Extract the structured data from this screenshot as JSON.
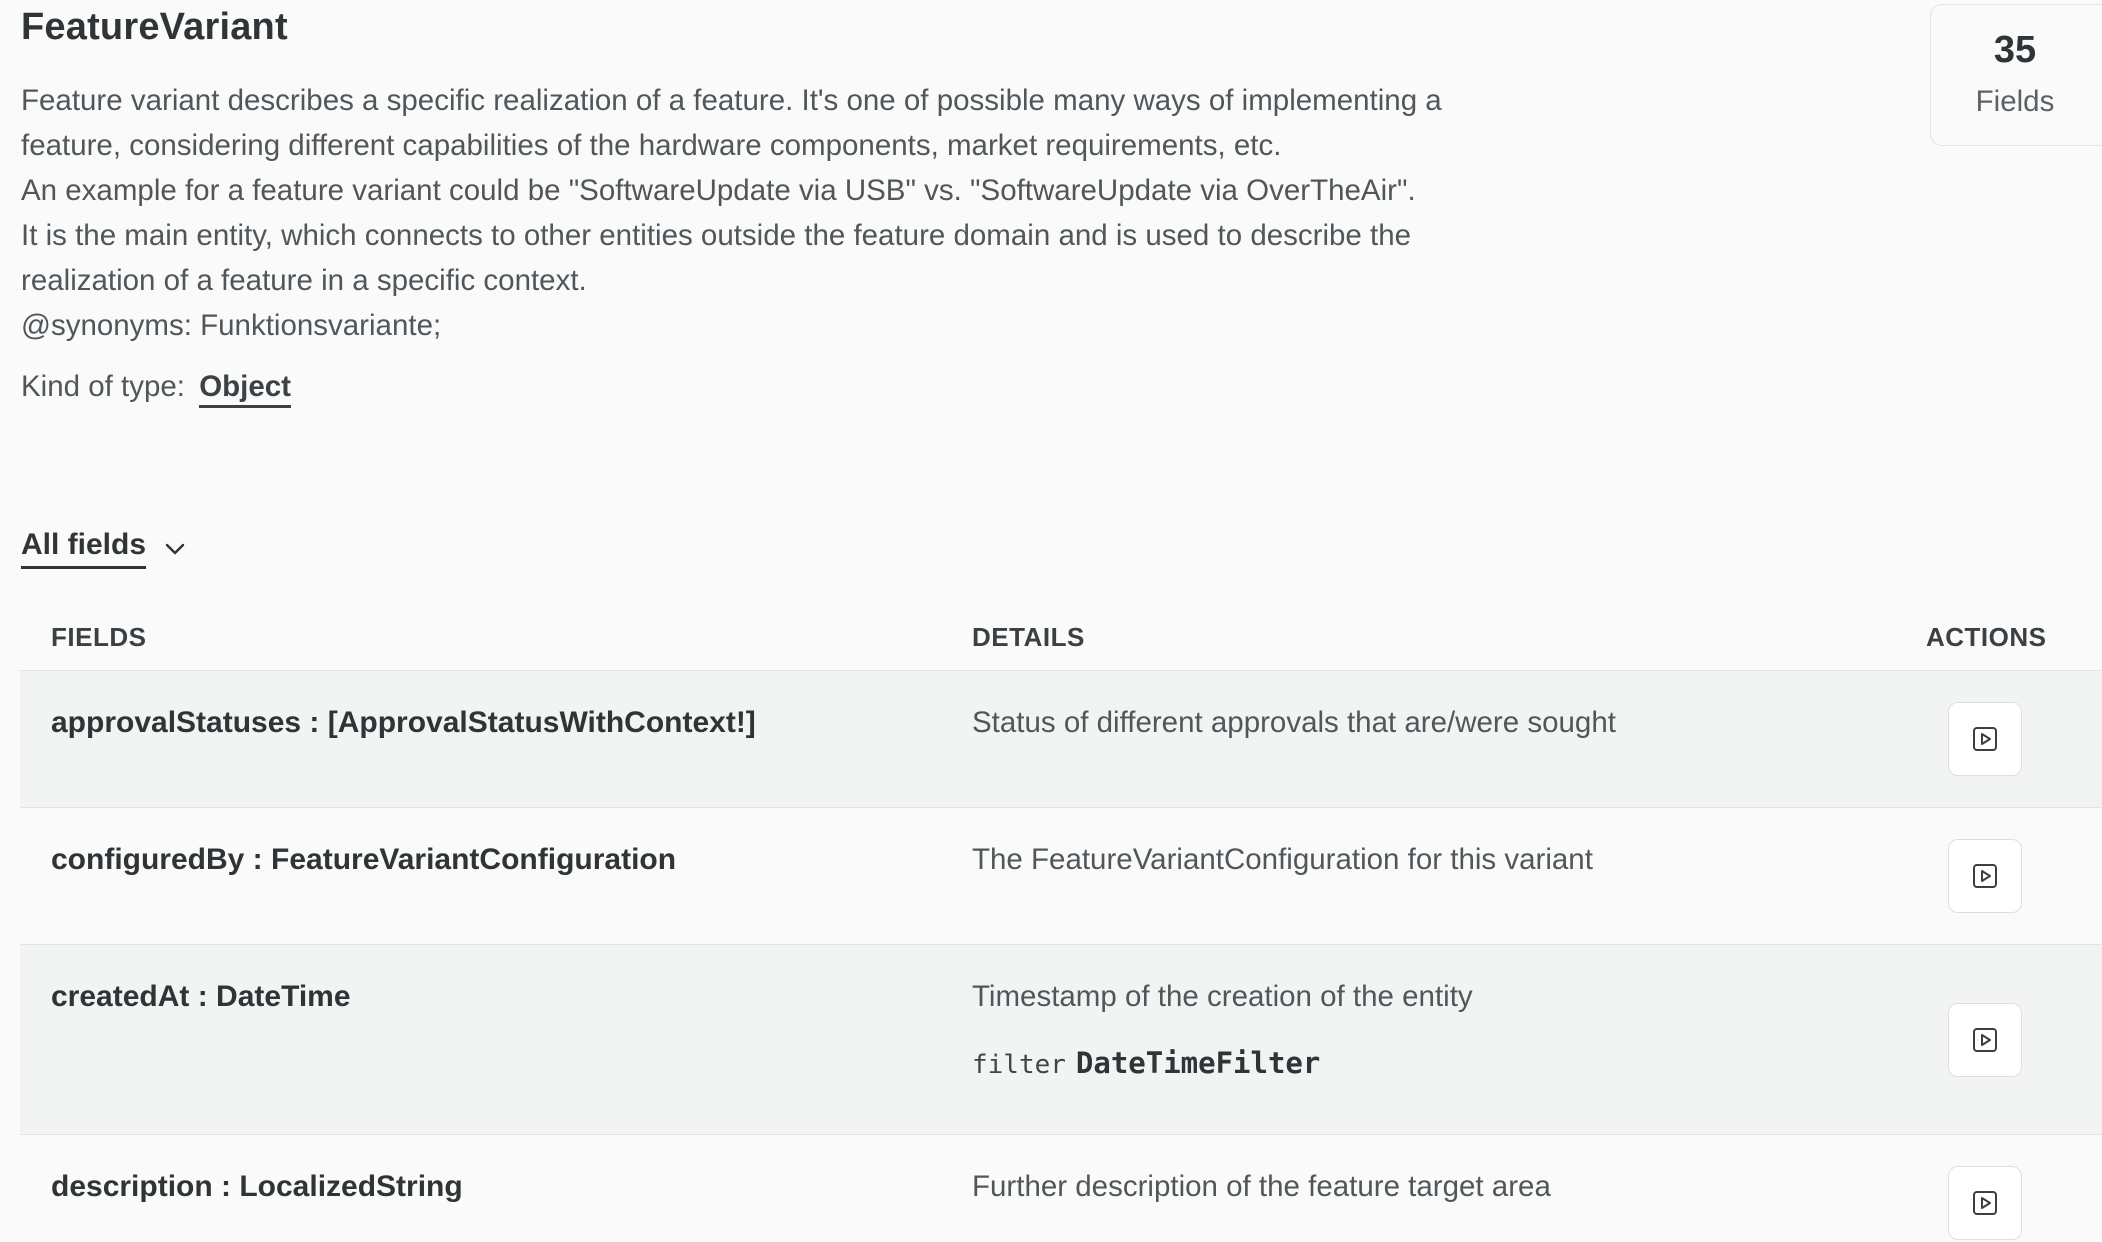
{
  "type": {
    "name": "FeatureVariant",
    "description_lines": [
      "Feature variant describes a specific realization of a feature. It's one of possible many ways of implementing a",
      "feature, considering different capabilities of the hardware components, market requirements, etc.",
      "An example for a feature variant could be \"SoftwareUpdate via USB\" vs. \"SoftwareUpdate via OverTheAir\".",
      "It is the main entity, which connects to other entities outside the feature domain and is used to describe the",
      "realization of a feature in a specific context.",
      "@synonyms: Funktionsvariante;"
    ],
    "kind_label": "Kind of type:",
    "kind_value": "Object"
  },
  "field_count": {
    "number": "35",
    "label": "Fields"
  },
  "filter": {
    "label": "All fields",
    "icon": "chevron-down-icon"
  },
  "table": {
    "headers": {
      "fields": "FIELDS",
      "details": "DETAILS",
      "actions": "ACTIONS"
    },
    "rows": [
      {
        "field": "approvalStatuses : [ApprovalStatusWithContext!]",
        "detail": "Status of different approvals that are/were sought"
      },
      {
        "field": "configuredBy : FeatureVariantConfiguration",
        "detail": "The FeatureVariantConfiguration for this variant"
      },
      {
        "field": "createdAt : DateTime",
        "detail": "Timestamp of the creation of the entity",
        "filter_keyword": "filter",
        "filter_type": "DateTimeFilter"
      },
      {
        "field": "description : LocalizedString",
        "detail": "Further description of the feature target area"
      }
    ],
    "action_icon": "play-icon"
  },
  "colors": {
    "text": "#2f3437",
    "muted": "#50575a",
    "row_shade": "#f2f4f4",
    "border": "#e2e4e5",
    "background": "#fafafa"
  }
}
